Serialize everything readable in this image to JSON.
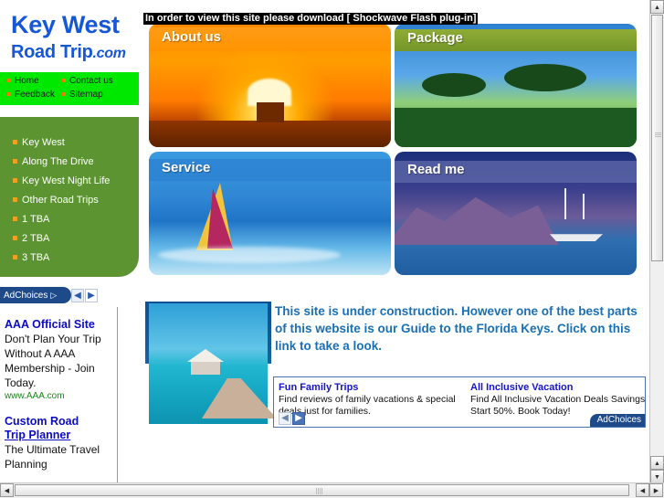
{
  "logo": {
    "line1": "Key West",
    "line2": "Road Trip",
    "suffix": ".com"
  },
  "topnav": [
    {
      "label": "Home"
    },
    {
      "label": "Contact us"
    },
    {
      "label": "Feedback"
    },
    {
      "label": "Sitemap"
    }
  ],
  "sidebar": {
    "items": [
      {
        "label": "Key West"
      },
      {
        "label": "Along The Drive"
      },
      {
        "label": "Key West Night   Life"
      },
      {
        "label": "Other Road Trips"
      },
      {
        "label": "1 TBA"
      },
      {
        "label": "2 TBA"
      },
      {
        "label": "3 TBA"
      }
    ]
  },
  "side_ad": {
    "tab_label": "AdChoices",
    "tab_triangle": "▷",
    "prev_arrow": "◀",
    "next_arrow": "▶",
    "ads": [
      {
        "title": "AAA Official Site",
        "body": "Don't Plan Your Trip Without A AAA Membership - Join Today.",
        "url": "www.AAA.com",
        "underlined": false
      },
      {
        "title_line1": "Custom Road",
        "title_line2": "Trip Planner",
        "body": "The Ultimate Travel Planning",
        "underlined": true
      }
    ]
  },
  "flash_bar": {
    "text": "In order to view this site please download [ Shockwave Flash plug-in]"
  },
  "tiles": [
    {
      "label": "About us",
      "name": "tile-about-us"
    },
    {
      "label": "Package",
      "name": "tile-package"
    },
    {
      "label": "Service",
      "name": "tile-service"
    },
    {
      "label": "Read me",
      "name": "tile-read-me"
    }
  ],
  "intro": {
    "text": "This site is under construction.  However one of the best parts of this website is our Guide to the Florida Keys.  Click on this link to take a look."
  },
  "bottom_ad": {
    "left": {
      "title": "Fun Family Trips",
      "body": "Find reviews of family vacations & special deals just for families."
    },
    "right": {
      "title": "All Inclusive Vacation",
      "body": "Find All Inclusive Vacation Deals Savings Start 50%. Book Today!"
    },
    "prev_arrow": "◀",
    "next_arrow": "▶",
    "badge": "AdChoices"
  },
  "scrollbars": {
    "up": "▲",
    "down": "▼",
    "left": "◀",
    "right": "▶"
  },
  "colors": {
    "logo_blue": "#1557d6",
    "nav_green": "#00e800",
    "panel_green": "#5b9431",
    "bullet_orange": "#f0a020",
    "link_blue": "#0b0bc0",
    "intro_blue": "#1a6fb5",
    "ad_navy": "#1f4a8a"
  }
}
